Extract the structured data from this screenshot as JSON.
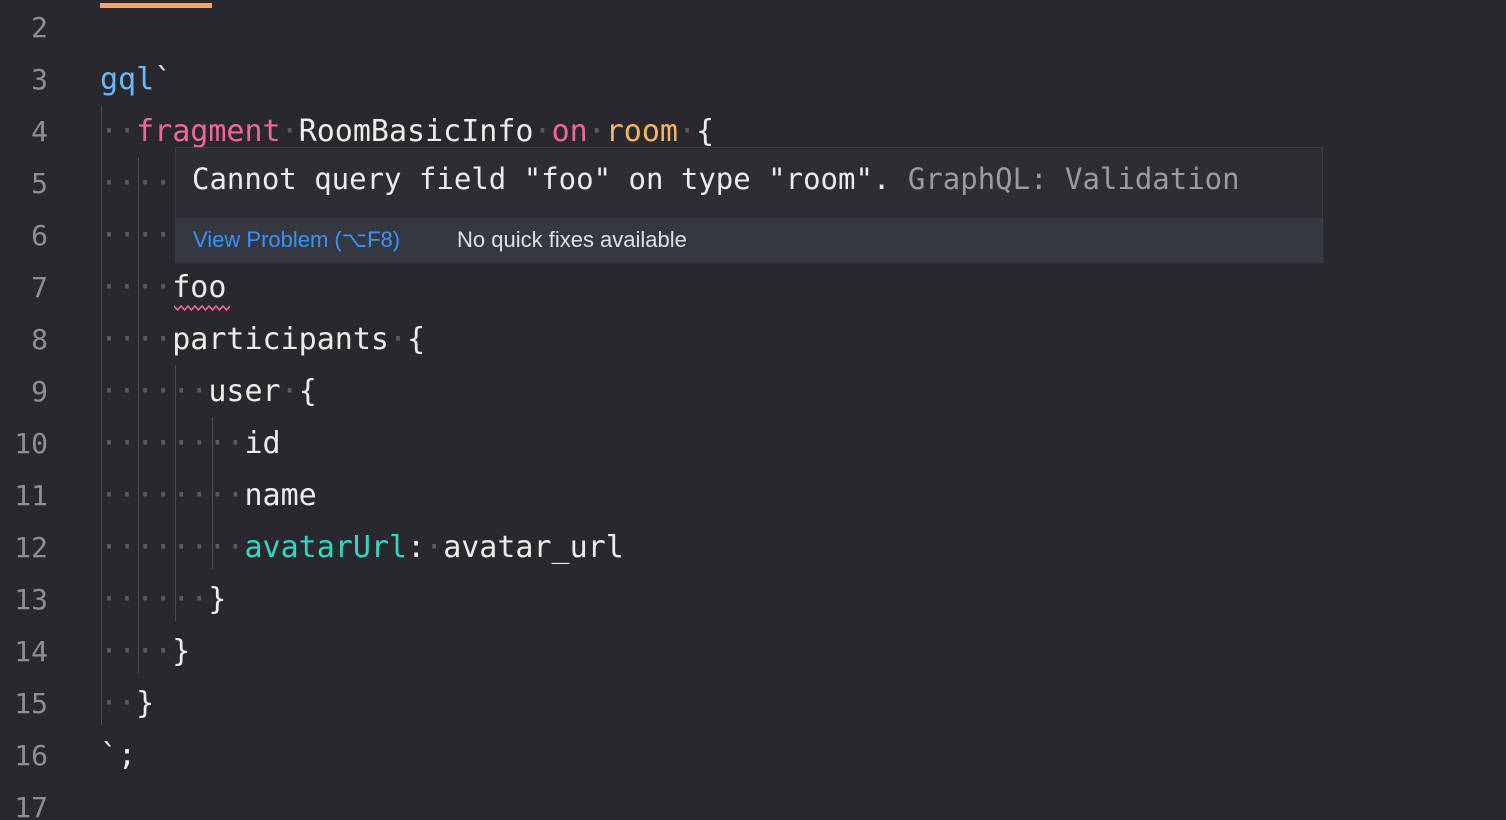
{
  "editor": {
    "lines": [
      {
        "number": "2",
        "segments": []
      },
      {
        "number": "3",
        "segments": [
          {
            "text": "gql",
            "cls": "tag-blue"
          },
          {
            "text": "`",
            "cls": "plain"
          }
        ]
      },
      {
        "number": "4",
        "segments": [
          {
            "text": "··",
            "cls": "ws"
          },
          {
            "text": "fragment",
            "cls": "kw-pink"
          },
          {
            "text": "·",
            "cls": "ws"
          },
          {
            "text": "RoomBasicInfo",
            "cls": "plain"
          },
          {
            "text": "·",
            "cls": "ws"
          },
          {
            "text": "on",
            "cls": "kw-pink"
          },
          {
            "text": "·",
            "cls": "ws"
          },
          {
            "text": "room",
            "cls": "kw-orange"
          },
          {
            "text": "·",
            "cls": "ws"
          },
          {
            "text": "{",
            "cls": "plain"
          }
        ]
      },
      {
        "number": "5",
        "segments": [
          {
            "text": "····",
            "cls": "ws"
          }
        ]
      },
      {
        "number": "6",
        "segments": [
          {
            "text": "····",
            "cls": "ws"
          }
        ]
      },
      {
        "number": "7",
        "segments": [
          {
            "text": "····",
            "cls": "ws"
          },
          {
            "text": "foo",
            "cls": "plain"
          }
        ]
      },
      {
        "number": "8",
        "segments": [
          {
            "text": "····",
            "cls": "ws"
          },
          {
            "text": "participants",
            "cls": "plain"
          },
          {
            "text": "·",
            "cls": "ws"
          },
          {
            "text": "{",
            "cls": "plain"
          }
        ]
      },
      {
        "number": "9",
        "segments": [
          {
            "text": "······",
            "cls": "ws"
          },
          {
            "text": "user",
            "cls": "plain"
          },
          {
            "text": "·",
            "cls": "ws"
          },
          {
            "text": "{",
            "cls": "plain"
          }
        ]
      },
      {
        "number": "10",
        "segments": [
          {
            "text": "········",
            "cls": "ws"
          },
          {
            "text": "id",
            "cls": "plain"
          }
        ]
      },
      {
        "number": "11",
        "segments": [
          {
            "text": "········",
            "cls": "ws"
          },
          {
            "text": "name",
            "cls": "plain"
          }
        ]
      },
      {
        "number": "12",
        "segments": [
          {
            "text": "········",
            "cls": "ws"
          },
          {
            "text": "avatarUrl",
            "cls": "field-cyan"
          },
          {
            "text": ":",
            "cls": "plain"
          },
          {
            "text": "·",
            "cls": "ws"
          },
          {
            "text": "avatar_url",
            "cls": "plain"
          }
        ]
      },
      {
        "number": "13",
        "segments": [
          {
            "text": "······",
            "cls": "ws"
          },
          {
            "text": "}",
            "cls": "plain"
          }
        ]
      },
      {
        "number": "14",
        "segments": [
          {
            "text": "····",
            "cls": "ws"
          },
          {
            "text": "}",
            "cls": "plain"
          }
        ]
      },
      {
        "number": "15",
        "segments": [
          {
            "text": "··",
            "cls": "ws"
          },
          {
            "text": "}",
            "cls": "plain"
          }
        ]
      },
      {
        "number": "16",
        "segments": [
          {
            "text": "`;",
            "cls": "plain"
          }
        ]
      },
      {
        "number": "17",
        "segments": []
      }
    ]
  },
  "hover": {
    "message": "Cannot query field \"foo\" on type \"room\".",
    "source": "GraphQL: Validation",
    "view_problem": "View Problem (⌥F8)",
    "no_quick_fixes": "No quick fixes available"
  },
  "colors": {
    "background": "#29292d",
    "error_squiggle": "#f0679a",
    "link": "#3794ff",
    "keyword": "#f0679a",
    "type": "#f6b36b",
    "tag": "#6bb8ff",
    "field_alias": "#33d6c4"
  }
}
